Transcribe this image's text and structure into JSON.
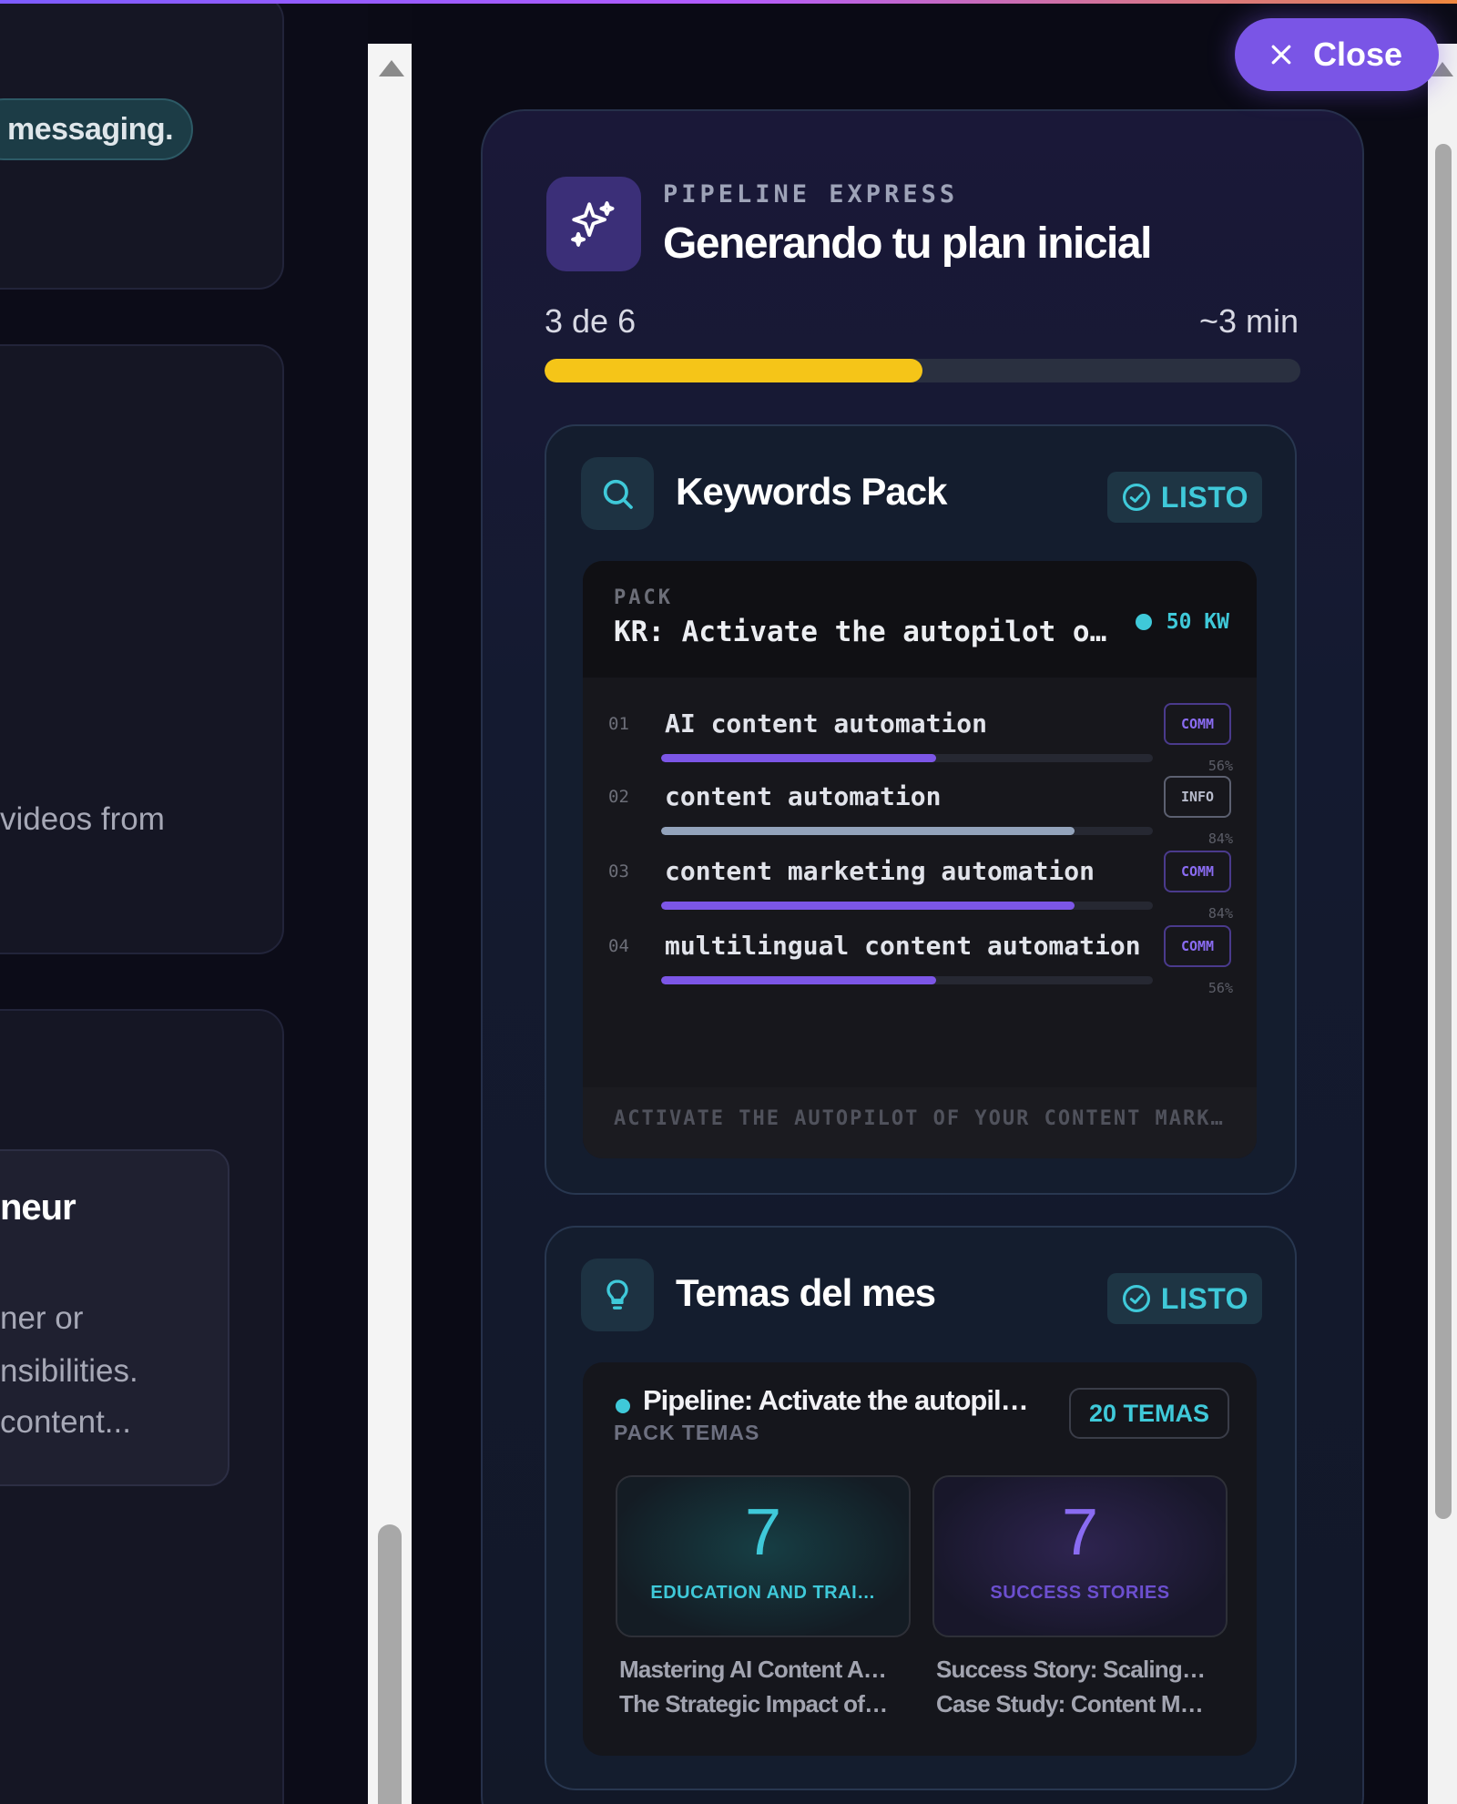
{
  "background_panel": {
    "pill_text": "messaging.",
    "text_line_1": "videos from",
    "card_title": "neur",
    "card_lines": [
      "ner or",
      "nsibilities.",
      "content..."
    ]
  },
  "close_button": {
    "label": "Close"
  },
  "header": {
    "eyebrow": "PIPELINE EXPRESS",
    "title": "Generando tu plan inicial",
    "icon": "sparkles-icon"
  },
  "progress": {
    "step_label": "3 de 6",
    "eta": "~3 min",
    "fraction": 0.5,
    "color": "#f5c518"
  },
  "keywords_section": {
    "title": "Keywords Pack",
    "icon": "search-icon",
    "status": "LISTO",
    "pack": {
      "eyebrow": "PACK",
      "title": "KR: Activate the autopilot o…",
      "count": "50 KW",
      "footer": "ACTIVATE THE AUTOPILOT OF YOUR CONTENT MARK…",
      "items": [
        {
          "num": "01",
          "text": "AI content automation",
          "tag": "COMM",
          "pct": "56%",
          "score": 0.56
        },
        {
          "num": "02",
          "text": "content automation",
          "tag": "INFO",
          "pct": "84%",
          "score": 0.84
        },
        {
          "num": "03",
          "text": "content marketing automation",
          "tag": "COMM",
          "pct": "84%",
          "score": 0.84
        },
        {
          "num": "04",
          "text": "multilingual content automation",
          "tag": "COMM",
          "pct": "56%",
          "score": 0.56
        }
      ]
    }
  },
  "topics_section": {
    "title": "Temas del mes",
    "icon": "lightbulb-icon",
    "status": "LISTO",
    "pack": {
      "title": "Pipeline: Activate the autopil…",
      "subtitle": "PACK TEMAS",
      "count": "20 TEMAS",
      "categories": [
        {
          "count": "7",
          "label": "EDUCATION AND TRAI…",
          "items": [
            "Mastering AI Content A…",
            "The Strategic Impact of…"
          ]
        },
        {
          "count": "7",
          "label": "SUCCESS STORIES",
          "items": [
            "Success Story: Scaling…",
            "Case Study: Content M…"
          ]
        }
      ]
    }
  },
  "colors": {
    "accent_purple": "#7a55e6",
    "accent_cyan": "#3fc9d9",
    "progress_yellow": "#f5c518"
  }
}
